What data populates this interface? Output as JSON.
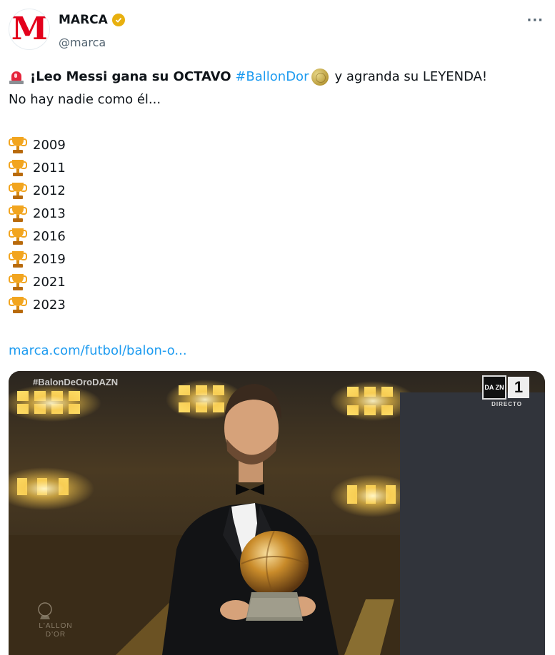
{
  "account": {
    "display_name": "MARCA",
    "handle": "@marca",
    "avatar_letter": "M",
    "verified_badge_color": "#e8b00f",
    "brand_color": "#e3001b"
  },
  "more_label": "···",
  "tweet": {
    "lead_icon": "police-light-icon",
    "headline_bold_1": "¡Leo Messi gana su OCTAVO",
    "hashtag": "#BallonDor",
    "hashtag_icon": "golden-ball-icon",
    "headline_bold_2": "y agranda su LEYENDA!",
    "subline": "No hay nadie como él...",
    "trophy_icon": "trophy-icon",
    "years": [
      "2009",
      "2011",
      "2012",
      "2013",
      "2016",
      "2019",
      "2021",
      "2023"
    ],
    "link": "marca.com/futbol/balon-o..."
  },
  "media": {
    "overlay_hashtag": "#BalonDeOroDAZN",
    "broadcaster_logo": "DA ZN",
    "channel_number": "1",
    "live_label": "DIRECTO",
    "watermark": "L'ALLON D'OR"
  },
  "colors": {
    "link": "#1d9bf0",
    "text": "#0f1419",
    "secondary": "#536471"
  }
}
